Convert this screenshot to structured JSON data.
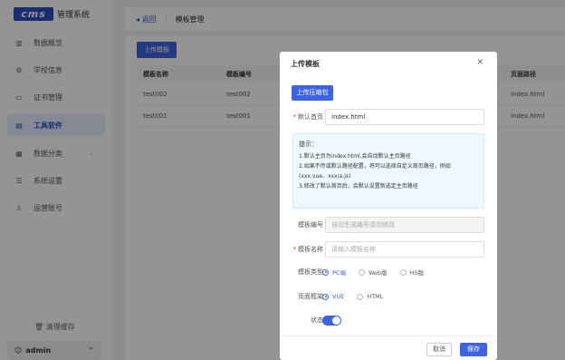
{
  "app": {
    "logo_text": "cms",
    "title": "管理系统"
  },
  "sidebar": {
    "items": [
      {
        "label": "数据概览",
        "icon": "bar-chart-icon"
      },
      {
        "label": "学校信息",
        "icon": "settings-icon"
      },
      {
        "label": "证书管理",
        "icon": "monitor-icon"
      },
      {
        "label": "工具软件",
        "icon": "folder-icon"
      },
      {
        "label": "数据分类",
        "icon": "grid-icon"
      },
      {
        "label": "系统设置",
        "icon": "list-icon"
      },
      {
        "label": "运营账号",
        "icon": "user-icon"
      }
    ],
    "clear_cache": "清理缓存",
    "user": "admin"
  },
  "topbar": {
    "back": "返回",
    "title": "模板管理"
  },
  "main": {
    "upload_button": "上传模板",
    "table": {
      "headers": [
        "模板名称",
        "模板编号",
        "页面路径"
      ],
      "rows": [
        {
          "name": "test002",
          "code": "test002",
          "path": "index.html"
        },
        {
          "name": "test001",
          "code": "test001",
          "path": "index.html"
        }
      ]
    }
  },
  "modal": {
    "title": "上传模板",
    "upload_file_button": "上传压缩包",
    "default_page_label": "默认首页",
    "default_page_value": "index.html",
    "tips_title": "提示：",
    "tips": [
      "1.默认主页为index.html,会自动默认主页路径",
      "2.如果不传或默认路径配置，将可以选择自定义首页路径，例如",
      "(xxx.vue、xxx/a.js)",
      "3.修改了默认首页后，会默认设置新选定主页路径"
    ],
    "code_label": "模板编号",
    "code_placeholder": "自动生成编号请勿修改",
    "name_label": "模板名称",
    "name_placeholder": "请输入模板名称",
    "type_label": "模板类型",
    "type_options": [
      "PC端",
      "Web版",
      "H5版"
    ],
    "type_selected": 0,
    "framework_label": "页面框架",
    "framework_options": [
      "VUE",
      "HTML"
    ],
    "framework_selected": 0,
    "status_label": "状态",
    "status_on": true,
    "cancel": "取消",
    "save": "保存"
  }
}
